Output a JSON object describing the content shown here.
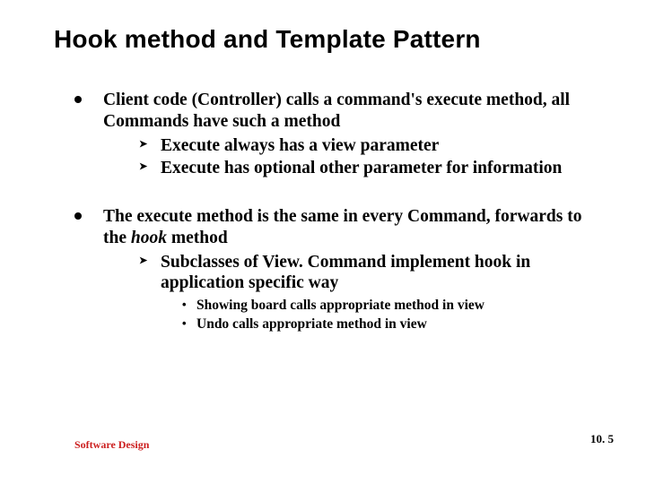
{
  "title": "Hook method and Template Pattern",
  "bullets": {
    "b1": {
      "text": "Client code (Controller) calls a command's execute method, all Commands have such a method",
      "children": {
        "c1": "Execute always has a view parameter",
        "c2": "Execute has optional other parameter for information"
      }
    },
    "b2": {
      "part1": "The execute method is the same in every Command, forwards to the ",
      "hook_word": "hook",
      "part2": " method",
      "children": {
        "c1": "Subclasses of View. Command implement hook in application specific way",
        "grandchildren": {
          "g1": "Showing board calls appropriate method in view",
          "g2": "Undo calls appropriate method in view"
        }
      }
    }
  },
  "footer": {
    "left": "Software Design",
    "right": "10. 5"
  },
  "markers": {
    "chevron": "➤",
    "interpunct": "•"
  }
}
